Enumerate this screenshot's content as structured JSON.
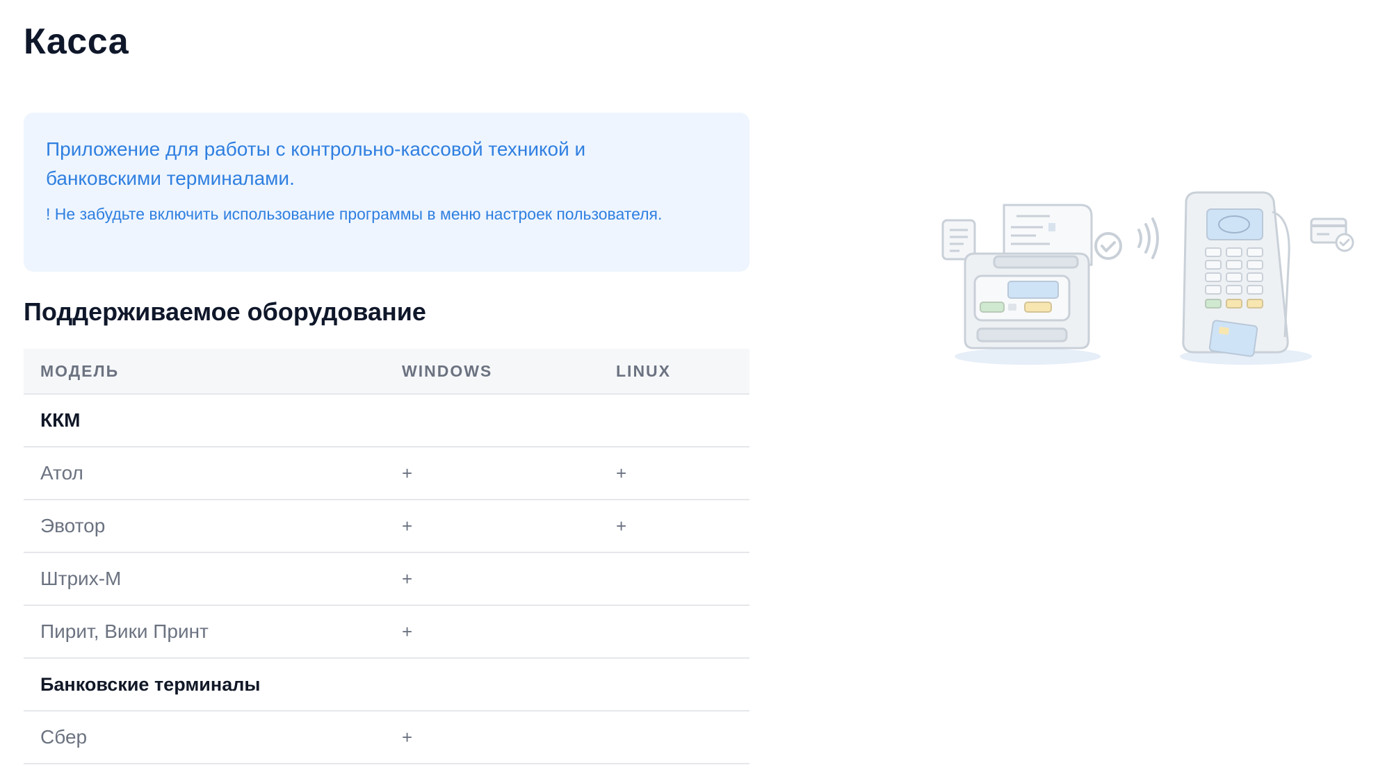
{
  "page": {
    "title": "Касса"
  },
  "info": {
    "main_text": "Приложение для работы с контрольно-кассовой техникой и банковскими терминалами.",
    "note_text": "! Не забудьте включить использование программы в меню настроек пользователя."
  },
  "equipment": {
    "section_title": "Поддерживаемое оборудование",
    "columns": {
      "model": "МОДЕЛЬ",
      "windows": "WINDOWS",
      "linux": "LINUX"
    },
    "groups": [
      {
        "name": "ККМ",
        "rows": [
          {
            "model": "Атол",
            "windows": "+",
            "linux": "+"
          },
          {
            "model": "Эвотор",
            "windows": "+",
            "linux": "+"
          },
          {
            "model": "Штрих-М",
            "windows": "+",
            "linux": ""
          },
          {
            "model": "Пирит, Вики Принт",
            "windows": "+",
            "linux": ""
          }
        ]
      },
      {
        "name": "Банковские терминалы",
        "rows": [
          {
            "model": "Сбер",
            "windows": "+",
            "linux": ""
          }
        ]
      }
    ]
  },
  "illustration": {
    "icons": [
      "receipt-printer-icon",
      "document-icon",
      "check-circle-icon",
      "contactless-waves-icon",
      "payment-terminal-icon",
      "credit-card-icon"
    ],
    "colors": {
      "stroke": "#c9d0d8",
      "fill": "#eef1f4",
      "screen": "#cfe3f7",
      "green_key": "#cfe8d0",
      "yellow_key": "#f7e6b0",
      "shadow": "#e6eef8"
    }
  }
}
